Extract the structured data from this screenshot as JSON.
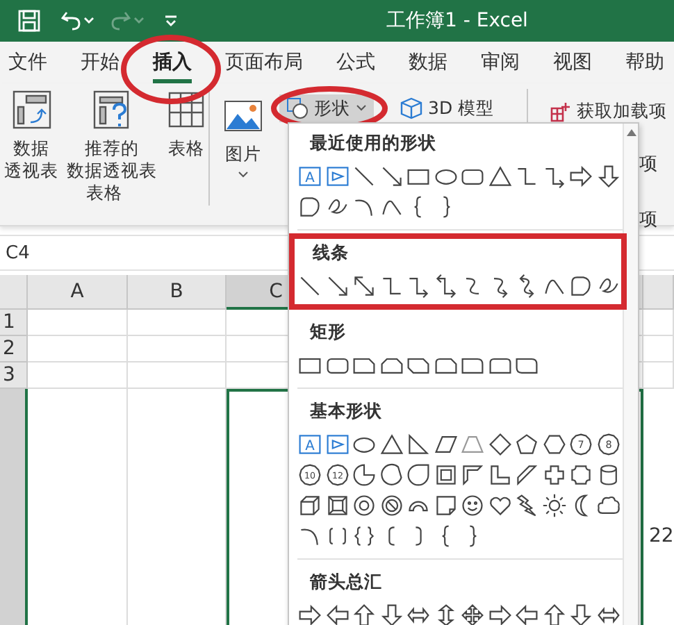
{
  "window": {
    "title": "工作簿1 - Excel"
  },
  "quick_access": {
    "redo_disabled": true
  },
  "tabs": [
    {
      "label": "文件",
      "selected": false,
      "circled": false
    },
    {
      "label": "开始",
      "selected": false,
      "circled": false
    },
    {
      "label": "插入",
      "selected": true,
      "circled": true
    },
    {
      "label": "页面布局",
      "selected": false,
      "circled": false
    },
    {
      "label": "公式",
      "selected": false,
      "circled": false
    },
    {
      "label": "数据",
      "selected": false,
      "circled": false
    },
    {
      "label": "审阅",
      "selected": false,
      "circled": false
    },
    {
      "label": "视图",
      "selected": false,
      "circled": false
    },
    {
      "label": "帮助",
      "selected": false,
      "circled": false
    }
  ],
  "ribbon": {
    "table_group": {
      "label": "表格",
      "buttons": [
        {
          "lines": [
            "数据",
            "透视表"
          ]
        },
        {
          "lines": [
            "推荐的",
            "数据透视表"
          ]
        },
        {
          "lines": [
            "表格"
          ]
        }
      ]
    },
    "picture": {
      "label": "图片"
    },
    "shapes": {
      "label": "形状",
      "expanded": true,
      "circled": true
    },
    "model_3d": {
      "label": "3D 模型"
    },
    "addins": {
      "label": "获取加载项"
    },
    "cut_texts": [
      "项",
      "项"
    ]
  },
  "name_box": "C4",
  "sheet": {
    "columns": [
      {
        "label": "A",
        "selected": false
      },
      {
        "label": "B",
        "selected": false
      },
      {
        "label": "C",
        "selected": true
      }
    ],
    "rows": [
      {
        "label": "1",
        "selected": false
      },
      {
        "label": "2",
        "selected": false
      },
      {
        "label": "3",
        "selected": false
      }
    ],
    "cut_text": "22"
  },
  "shapes_menu": {
    "sections": [
      {
        "title": "最近使用的形状",
        "badges": [
          "A"
        ]
      },
      {
        "title": "线条",
        "boxed": true
      },
      {
        "title": "矩形"
      },
      {
        "title": "基本形状",
        "badges": [
          "A",
          "7",
          "8",
          "10",
          "12"
        ]
      },
      {
        "title": "箭头总汇"
      }
    ]
  }
}
